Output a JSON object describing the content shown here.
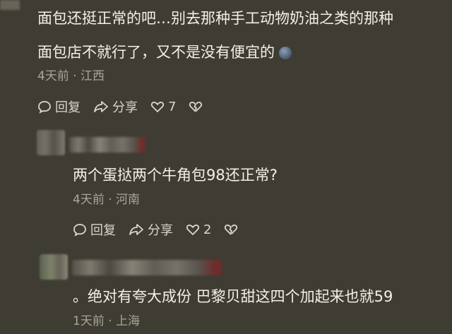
{
  "comment1": {
    "line1": "面包还挺正常的吧…别去那种手工动物奶油之类的那种",
    "line2": "面包店不就行了，又不是没有便宜的",
    "emoji_icon": "blue-face-emoji",
    "meta": "4天前 · 江西",
    "reply_label": "回复",
    "share_label": "分享",
    "like_count": "7"
  },
  "comment2": {
    "text": "两个蛋挞两个牛角包98还正常?",
    "meta": "4天前 · 河南",
    "reply_label": "回复",
    "share_label": "分享",
    "like_count": "2"
  },
  "comment3": {
    "text": "。绝对有夸大成份 巴黎贝甜这四个加起来也就59",
    "meta": "1天前 · 上海"
  },
  "colors": {
    "background": "#3f3c33",
    "text": "#f2f0ea",
    "meta": "#a9a59b"
  }
}
